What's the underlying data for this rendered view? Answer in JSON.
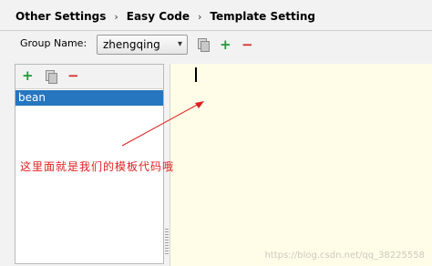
{
  "breadcrumb": [
    "Other Settings",
    "Easy Code",
    "Template Setting"
  ],
  "group": {
    "label": "Group Name:",
    "selected": "zhengqing"
  },
  "icons": {
    "copy": "copy-icon",
    "add": "+",
    "remove": "−"
  },
  "template_list": [
    "bean"
  ],
  "annotation": "这里面就是我们的模板代码哦",
  "watermark": "https://blog.csdn.net/qq_38225558",
  "colors": {
    "accent": "#2675bf",
    "add": "#1e9a37",
    "remove": "#d72b2b",
    "annotation": "#e02020",
    "editor_bg": "#fffde7"
  }
}
